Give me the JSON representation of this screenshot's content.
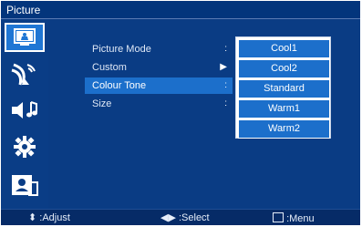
{
  "window": {
    "title": "Picture"
  },
  "sidebar": {
    "items": [
      {
        "name": "Picture",
        "icon": "picture-icon",
        "selected": true
      },
      {
        "name": "Channel",
        "icon": "antenna-icon",
        "selected": false
      },
      {
        "name": "Sound",
        "icon": "sound-icon",
        "selected": false
      },
      {
        "name": "Settings",
        "icon": "gear-icon",
        "selected": false
      },
      {
        "name": "Lock",
        "icon": "lock-person-icon",
        "selected": false
      }
    ]
  },
  "menu": {
    "items": [
      {
        "label": "Picture Mode",
        "marker": ":"
      },
      {
        "label": "Custom",
        "marker": "▶"
      },
      {
        "label": "Colour Tone",
        "marker": ":"
      },
      {
        "label": "Size",
        "marker": ":"
      }
    ],
    "selected_index": 2
  },
  "options": {
    "items": [
      "Cool1",
      "Cool2",
      "Standard",
      "Warm1",
      "Warm2"
    ]
  },
  "footer": {
    "adjust": "Adjust",
    "select": ":Select",
    "menu": ":Menu"
  },
  "colors": {
    "background": "#03357c",
    "highlight": "#1c6fcb",
    "active_tab": "#1f76d4"
  }
}
